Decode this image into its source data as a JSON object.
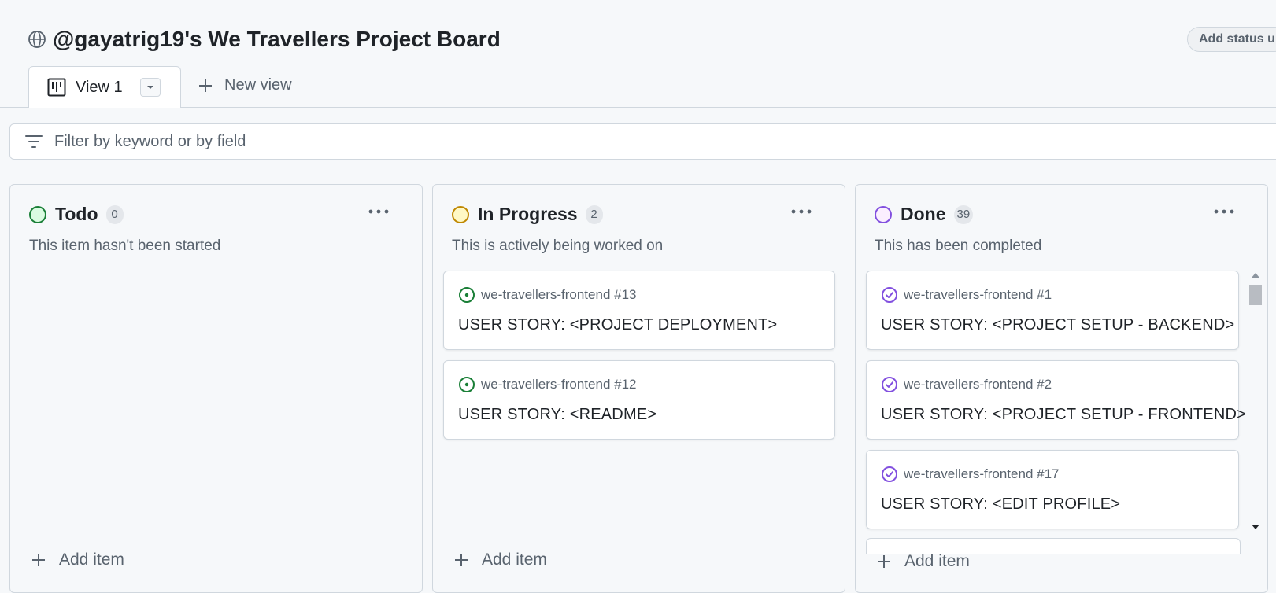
{
  "header": {
    "title": "@gayatrig19's We Travellers Project Board",
    "status_button": "Add status u"
  },
  "tabs": {
    "active_label": "View 1",
    "new_view_label": "New view"
  },
  "filter": {
    "placeholder": "Filter by keyword or by field"
  },
  "columns": [
    {
      "title": "Todo",
      "count": "0",
      "description": "This item hasn't been started",
      "status_color": "#1a7f37",
      "add_label": "Add item"
    },
    {
      "title": "In Progress",
      "count": "2",
      "description": "This is actively being worked on",
      "status_color": "#bf8700",
      "add_label": "Add item",
      "cards": [
        {
          "repo": "we-travellers-frontend #13",
          "title": "USER STORY: <PROJECT DEPLOYMENT>",
          "icon": "open-issue-icon"
        },
        {
          "repo": "we-travellers-frontend #12",
          "title": "USER STORY: <README>",
          "icon": "open-issue-icon"
        }
      ]
    },
    {
      "title": "Done",
      "count": "39",
      "description": "This has been completed",
      "status_color": "#8250df",
      "add_label": "Add item",
      "cards": [
        {
          "repo": "we-travellers-frontend #1",
          "title": "USER STORY: <PROJECT SETUP - BACKEND>",
          "icon": "closed-issue-icon"
        },
        {
          "repo": "we-travellers-frontend #2",
          "title": "USER STORY: <PROJECT SETUP - FRONTEND>",
          "icon": "closed-issue-icon"
        },
        {
          "repo": "we-travellers-frontend #17",
          "title": "USER STORY: <EDIT PROFILE>",
          "icon": "closed-issue-icon"
        }
      ]
    }
  ]
}
